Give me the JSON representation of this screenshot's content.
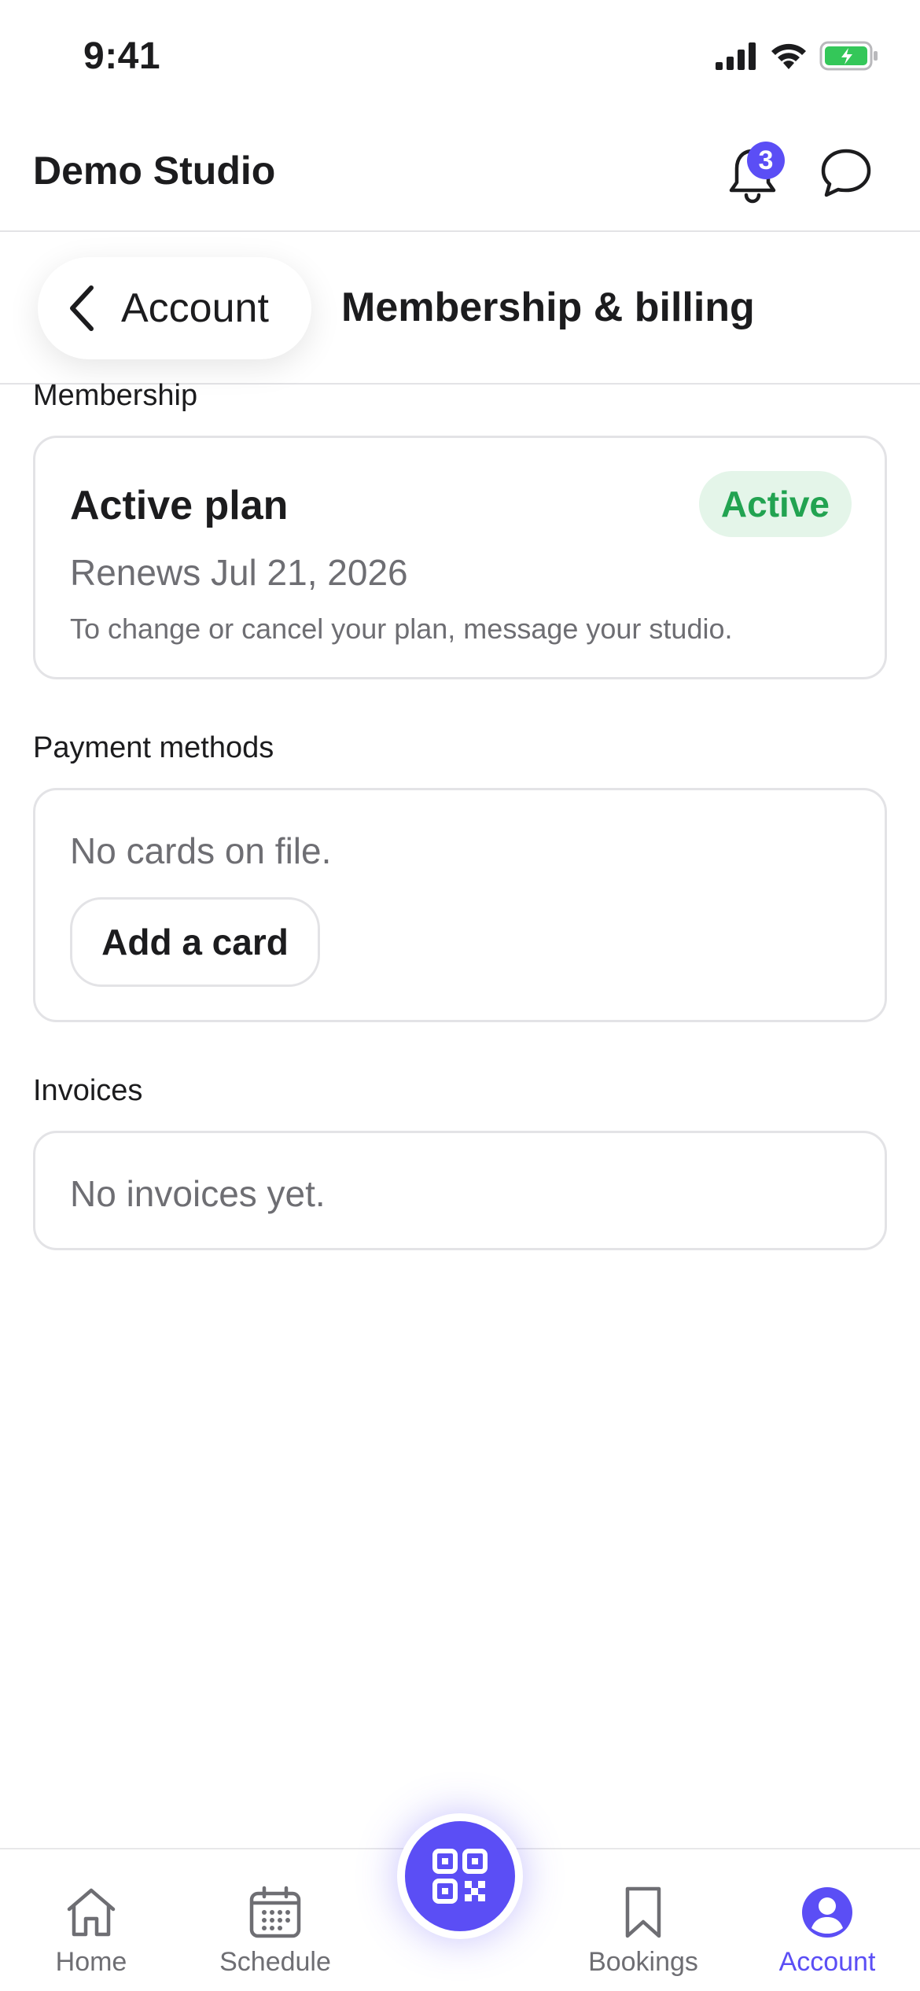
{
  "status_bar": {
    "time": "9:41"
  },
  "header": {
    "title": "Demo Studio",
    "notification_count": "3"
  },
  "nav": {
    "back_label": "Account",
    "title": "Membership & billing"
  },
  "membership": {
    "section_label": "Membership",
    "plan_title": "Active plan",
    "status": "Active",
    "renews": "Renews Jul 21, 2026",
    "note": "To change or cancel your plan, message your studio."
  },
  "payment": {
    "section_label": "Payment methods",
    "empty_text": "No cards on file.",
    "add_card_label": "Add a card"
  },
  "invoices": {
    "section_label": "Invoices",
    "empty_text": "No invoices yet."
  },
  "tabs": [
    {
      "label": "Home",
      "icon": "home-icon"
    },
    {
      "label": "Schedule",
      "icon": "calendar-icon"
    },
    {
      "label": "Bookings",
      "icon": "bookmark-icon"
    },
    {
      "label": "Account",
      "icon": "account-icon",
      "active": true
    }
  ],
  "colors": {
    "accent": "#5b4ef5",
    "success": "#22a351",
    "success_bg": "#e4f5e9",
    "battery": "#34c759"
  }
}
